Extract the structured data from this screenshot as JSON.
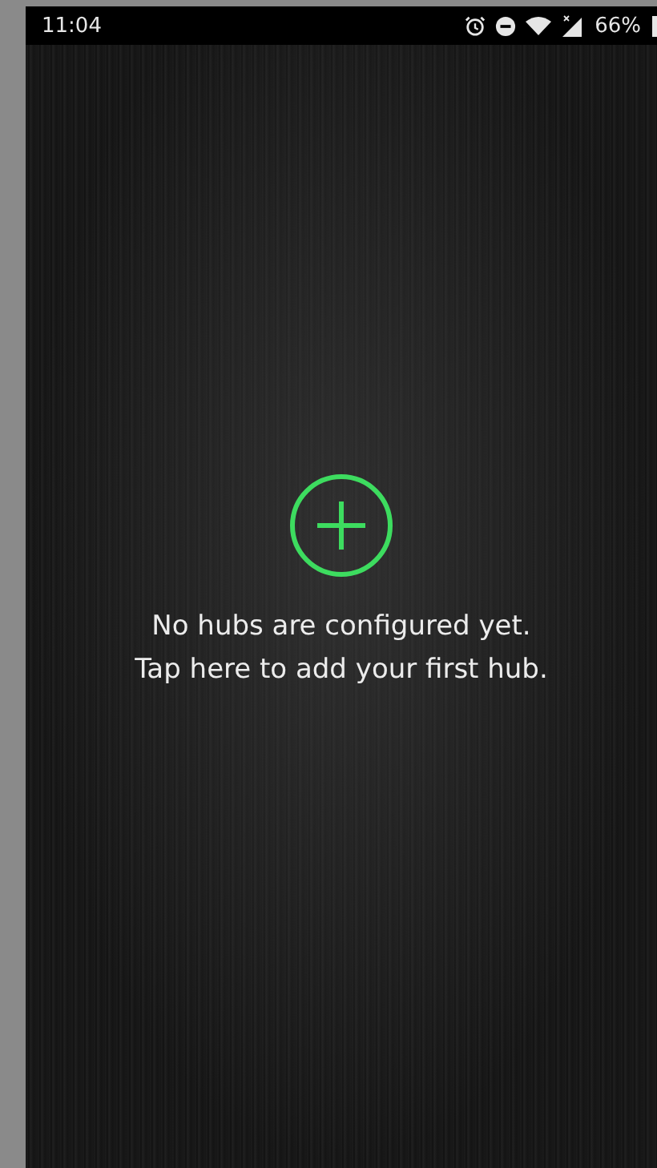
{
  "status_bar": {
    "time": "11:04",
    "battery": "66%"
  },
  "empty_state": {
    "lines": [
      "No hubs are configured yet.",
      "Tap here to add your first hub."
    ]
  }
}
